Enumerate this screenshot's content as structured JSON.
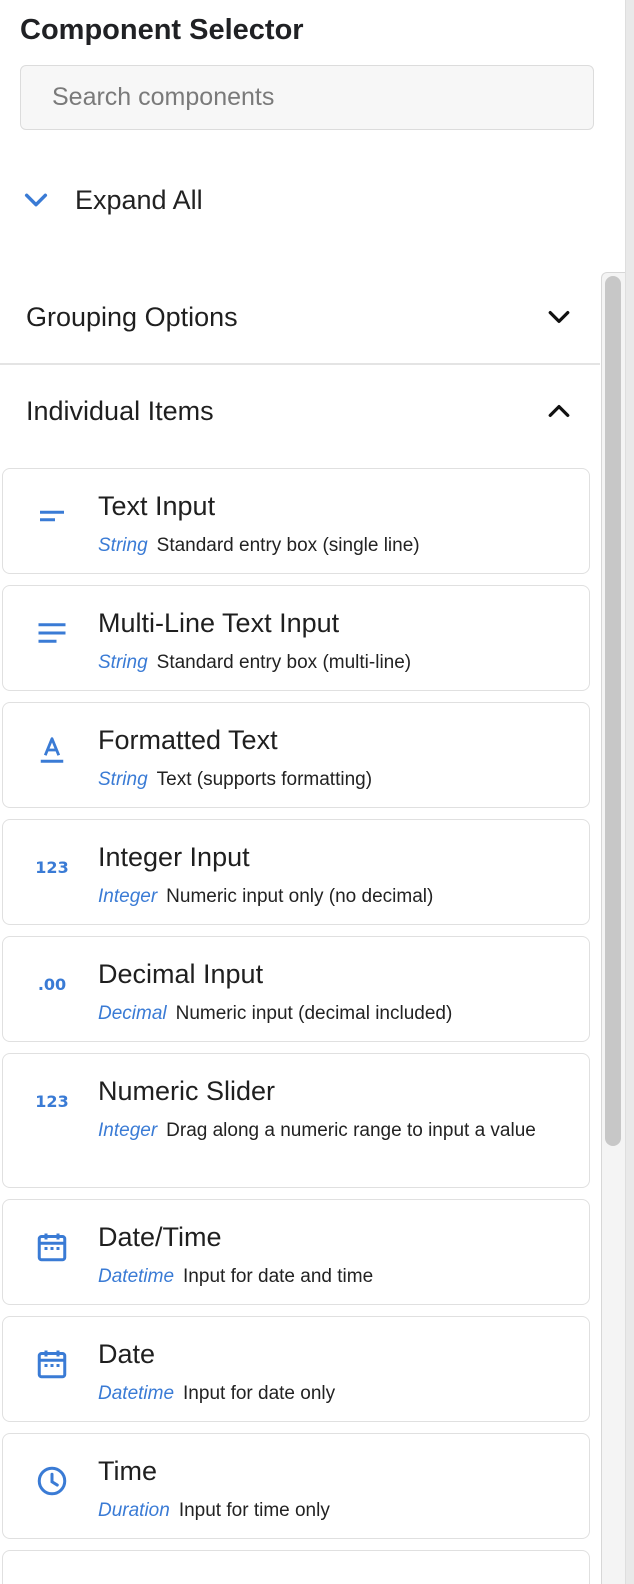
{
  "title": "Component Selector",
  "search": {
    "placeholder": "Search components",
    "value": ""
  },
  "expand_all": {
    "label": "Expand All",
    "icon": "chevron-down-icon"
  },
  "sections": [
    {
      "label": "Grouping Options",
      "icon": "chevron-down-icon",
      "expanded": false
    },
    {
      "label": "Individual Items",
      "icon": "chevron-up-icon",
      "expanded": true
    }
  ],
  "items": [
    {
      "name": "Text Input",
      "type": "String",
      "desc": "Standard entry box (single line)",
      "icon": "short-text-icon"
    },
    {
      "name": "Multi-Line Text Input",
      "type": "String",
      "desc": "Standard entry box (multi-line)",
      "icon": "notes-icon"
    },
    {
      "name": "Formatted Text",
      "type": "String",
      "desc": "Text (supports formatting)",
      "icon": "text-format-icon"
    },
    {
      "name": "Integer Input",
      "type": "Integer",
      "desc": "Numeric input only (no decimal)",
      "icon": "number-123-icon",
      "icon_text": "123"
    },
    {
      "name": "Decimal Input",
      "type": "Decimal",
      "desc": "Numeric input (decimal included)",
      "icon": "decimal-icon",
      "icon_text": ".00"
    },
    {
      "name": "Numeric Slider",
      "type": "Integer",
      "desc": "Drag along a numeric range to input a value",
      "icon": "number-123-icon",
      "icon_text": "123"
    },
    {
      "name": "Date/Time",
      "type": "Datetime",
      "desc": "Input for date and time",
      "icon": "calendar-icon"
    },
    {
      "name": "Date",
      "type": "Datetime",
      "desc": "Input for date only",
      "icon": "calendar-icon"
    },
    {
      "name": "Time",
      "type": "Duration",
      "desc": "Input for time only",
      "icon": "clock-icon"
    }
  ],
  "colors": {
    "accent": "#3a7bd5",
    "text": "#1f1f1f",
    "border": "#e0e0e0"
  }
}
